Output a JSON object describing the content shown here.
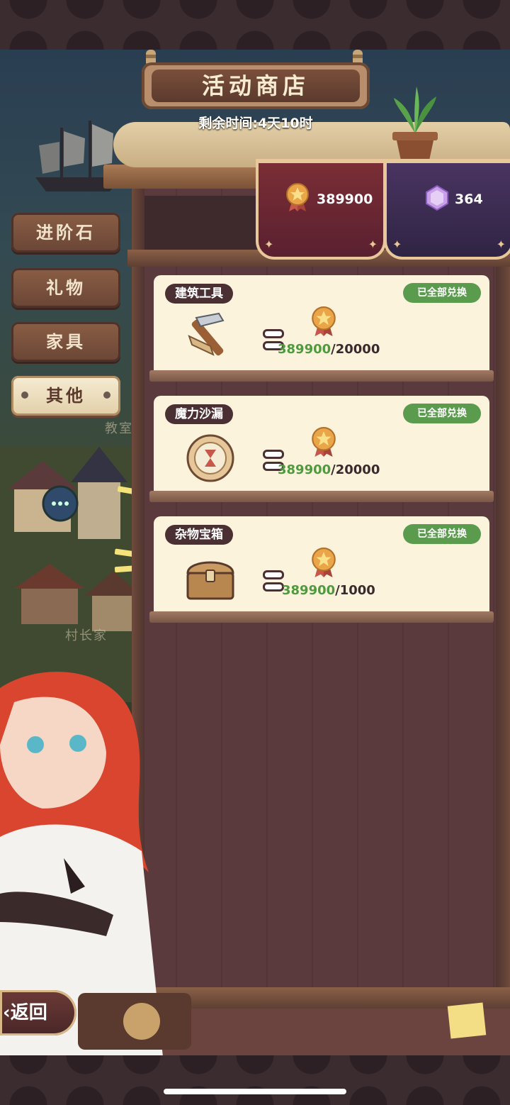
{
  "header": {
    "title": "活动商店",
    "remaining_time": "剩余时间:4天10时"
  },
  "currencies": [
    {
      "icon": "star-medal-icon",
      "value": "389900"
    },
    {
      "icon": "purple-gem-icon",
      "value": "364"
    }
  ],
  "side_tabs": [
    {
      "label": "进阶石",
      "active": false
    },
    {
      "label": "礼物",
      "active": false
    },
    {
      "label": "家具",
      "active": false
    },
    {
      "label": "其他",
      "active": true
    }
  ],
  "items": [
    {
      "name": "建筑工具",
      "icon": "hammer-tool-icon",
      "status": "已全部兑换",
      "have": "389900",
      "need": "20000"
    },
    {
      "name": "魔力沙漏",
      "icon": "magic-hourglass-icon",
      "status": "已全部兑换",
      "have": "389900",
      "need": "20000"
    },
    {
      "name": "杂物宝箱",
      "icon": "treasure-chest-icon",
      "status": "已全部兑换",
      "have": "389900",
      "need": "1000"
    }
  ],
  "map_labels": [
    "教室",
    "村长家"
  ],
  "back_button": {
    "label": "返回"
  },
  "colors": {
    "have_amount": "#4f9a3f",
    "redeemed_badge": "#5b9b4e",
    "gold_banner": "#7a2e35",
    "gem_banner": "#4a3460"
  }
}
